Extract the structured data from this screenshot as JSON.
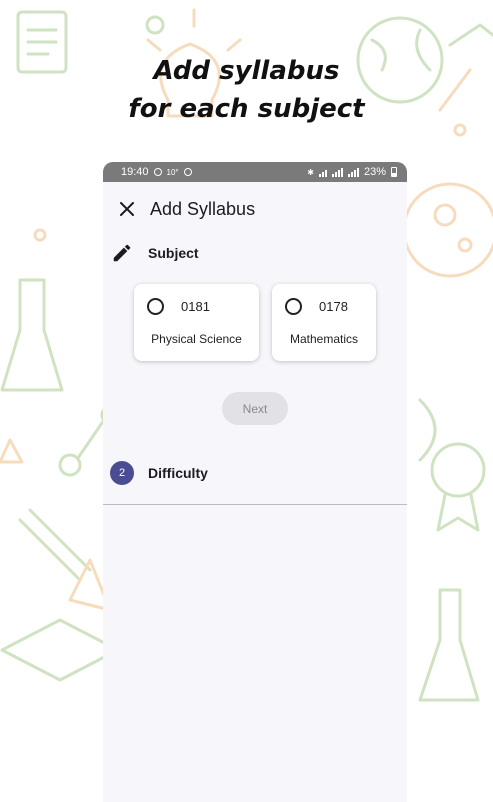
{
  "headline": {
    "line1": "Add syllabus",
    "line2": "for each subject"
  },
  "status_bar": {
    "time": "19:40",
    "temp": "10°",
    "battery": "23%"
  },
  "app_bar": {
    "close_icon": "close-icon",
    "title": "Add Syllabus"
  },
  "steps": [
    {
      "icon": "pencil-icon",
      "label": "Subject",
      "state": "active"
    },
    {
      "number": "2",
      "label": "Difficulty",
      "state": "pending"
    }
  ],
  "subjects": [
    {
      "code": "0181",
      "name": "Physical Science",
      "selected": false
    },
    {
      "code": "0178",
      "name": "Mathematics",
      "selected": false
    }
  ],
  "next_button": {
    "label": "Next",
    "enabled": false
  },
  "colors": {
    "accent": "#4a4d91",
    "doodle_green": "#cfe3c2",
    "doodle_orange": "#f6dcbc",
    "status_bar": "#7a7a7a"
  }
}
